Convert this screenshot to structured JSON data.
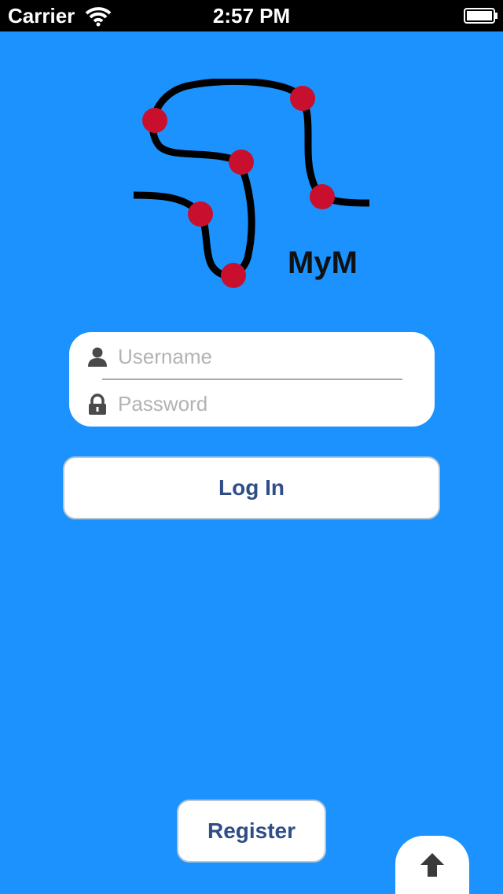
{
  "status_bar": {
    "carrier": "Carrier",
    "time": "2:57 PM",
    "icons": [
      "wifi-icon",
      "battery-icon"
    ]
  },
  "brand": {
    "name": "MyM",
    "logo_icon": "route-logo-icon"
  },
  "login_form": {
    "username_placeholder": "Username",
    "username_value": "",
    "password_placeholder": "Password",
    "password_value": "",
    "username_icon": "user-icon",
    "password_icon": "lock-icon"
  },
  "buttons": {
    "login_label": "Log In",
    "register_label": "Register",
    "up_icon": "up-arrow-icon"
  },
  "colors": {
    "background": "#1b92fd",
    "button_text": "#2f4d86",
    "logo_dots": "#c8102e",
    "logo_line": "#000000"
  }
}
